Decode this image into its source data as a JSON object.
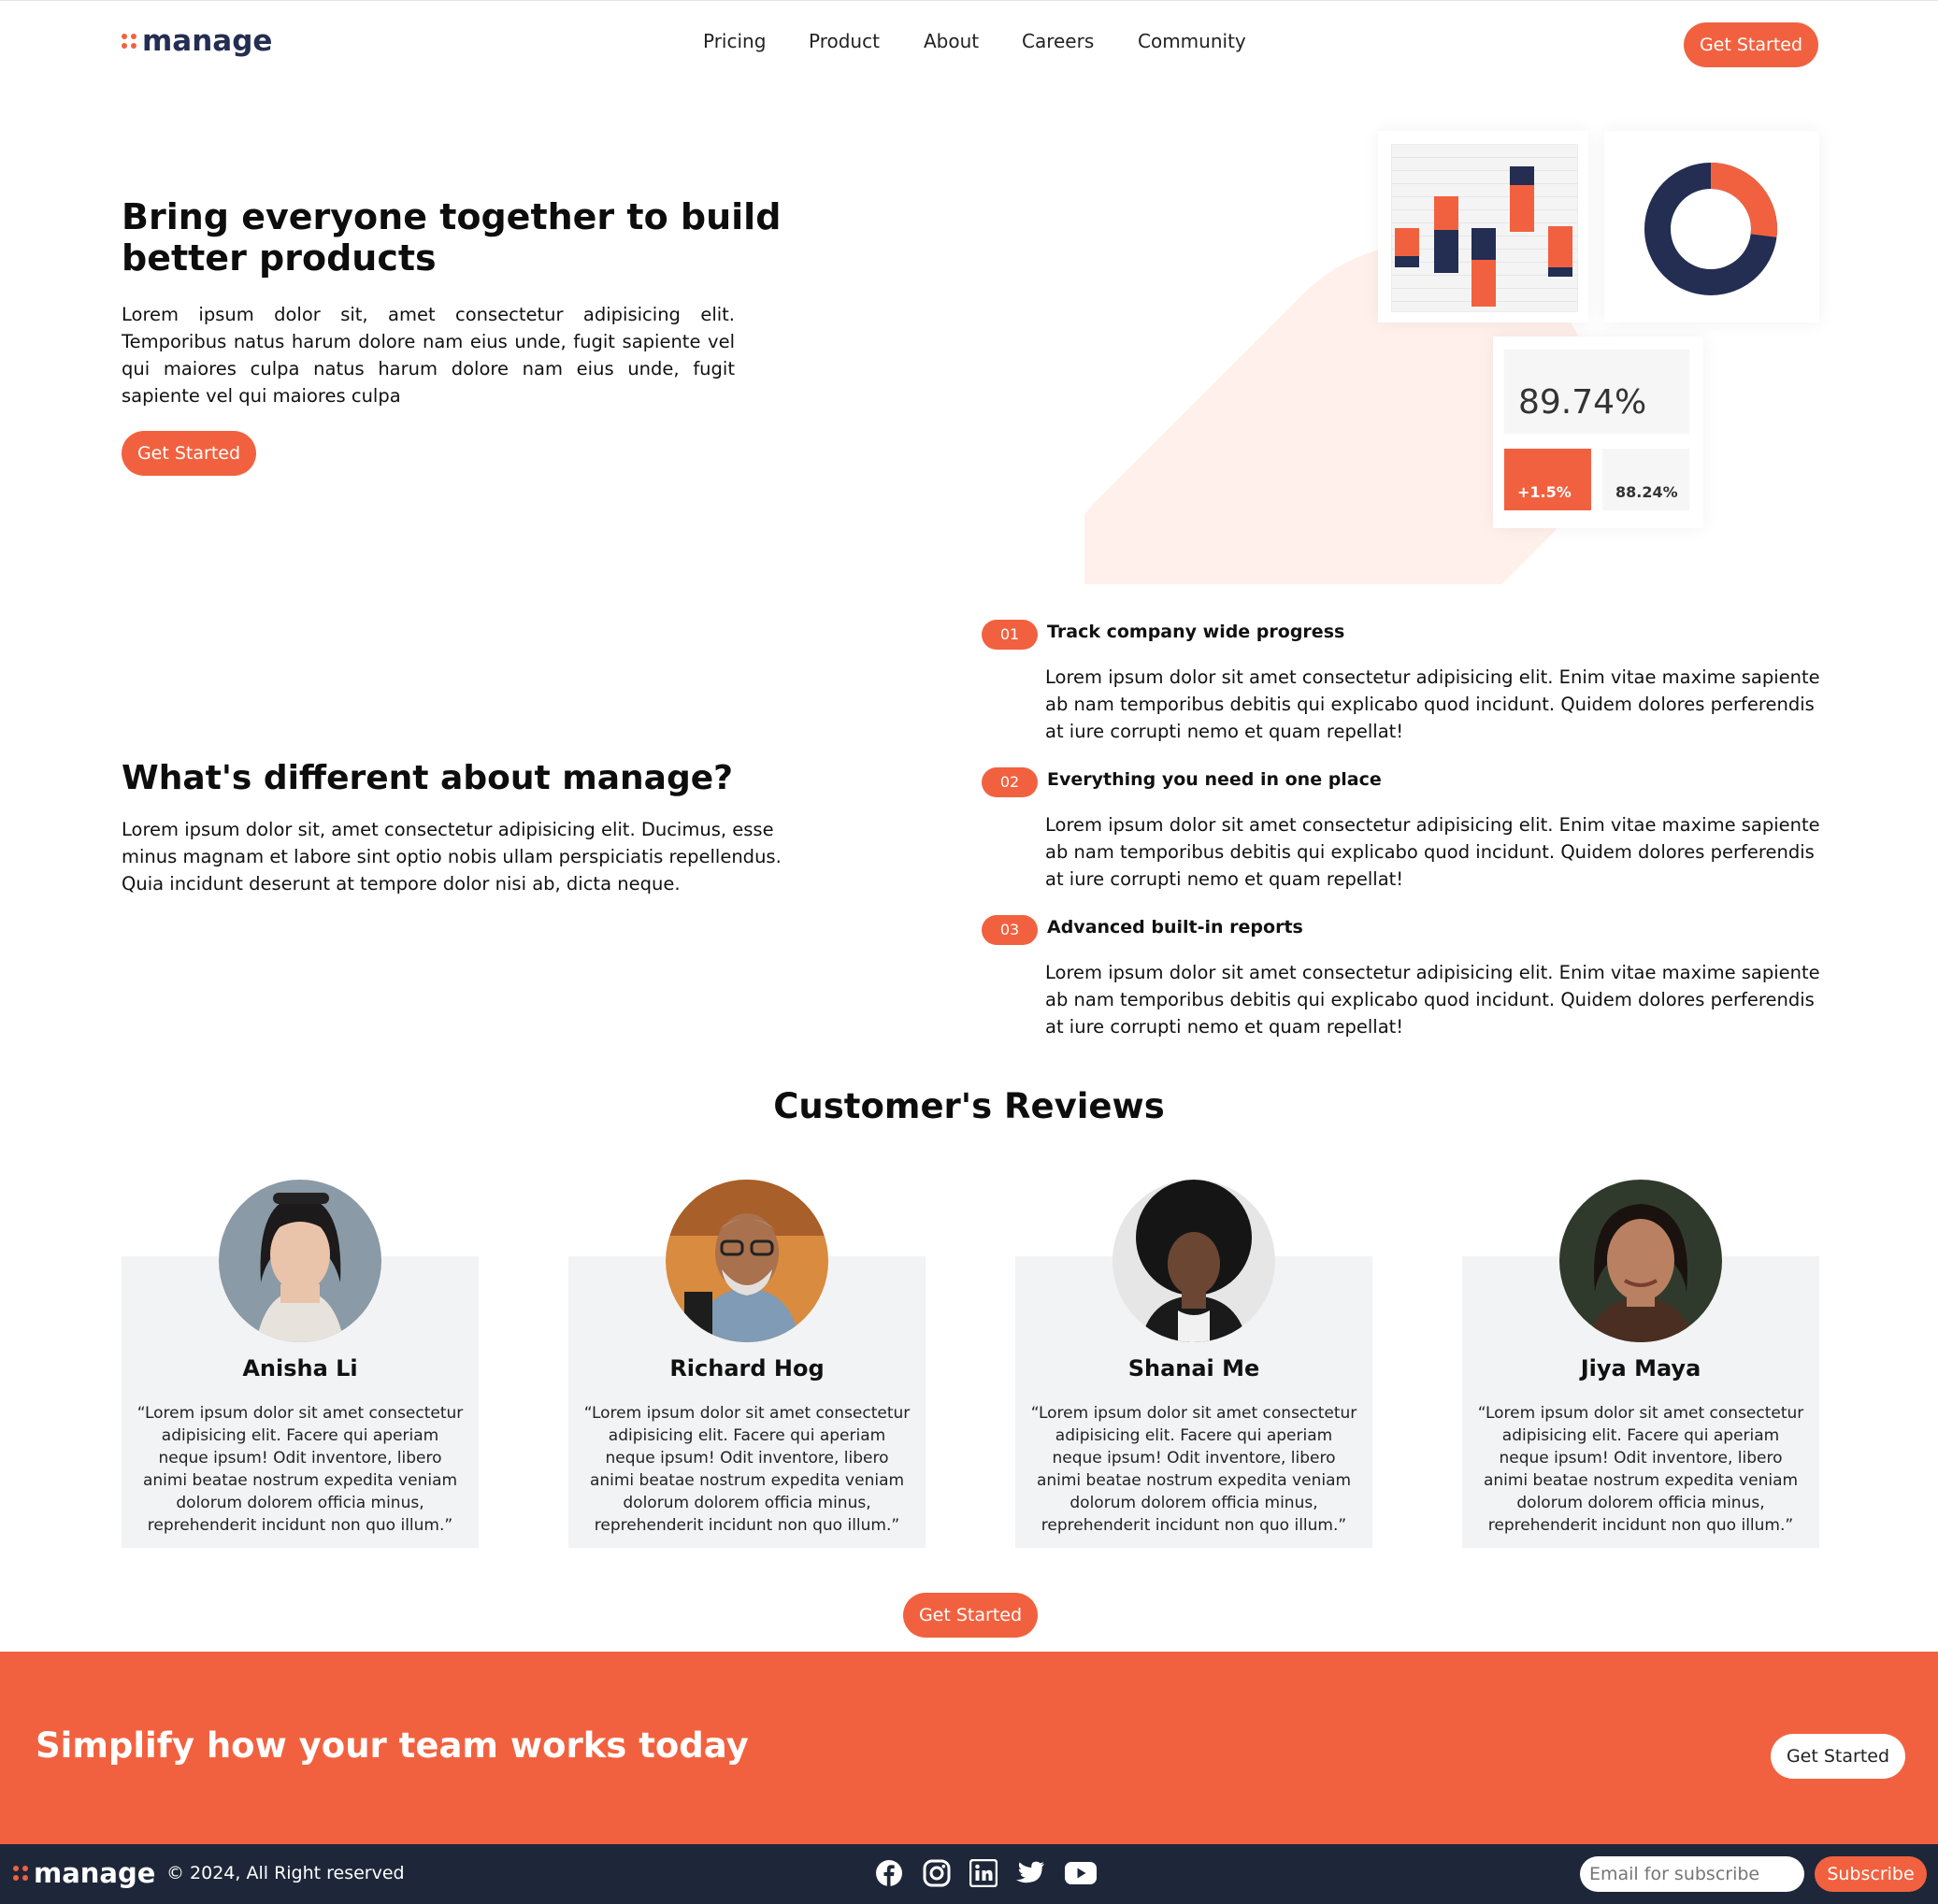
{
  "colors": {
    "accent": "#f2613f",
    "navy": "#242d52",
    "footer_bg": "#1e2739",
    "card_bg": "#f2f3f4",
    "blob": "#fff0ec"
  },
  "header": {
    "logo_text": "manage",
    "nav": [
      "Pricing",
      "Product",
      "About",
      "Careers",
      "Community"
    ],
    "cta_label": "Get Started"
  },
  "hero": {
    "title": "Bring everyone together to build better products",
    "text": "Lorem ipsum dolor sit, amet consectetur adipisicing elit. Temporibus natus harum dolore nam eius unde, fugit sapiente vel qui maiores culpa natus harum dolore nam eius unde, fugit sapiente vel qui maiores culpa",
    "cta_label": "Get Started",
    "stats": {
      "main": "89.74%",
      "change": "+1.5%",
      "secondary": "88.24%"
    },
    "donut_fraction": 0.27
  },
  "different": {
    "title": "What's different about manage?",
    "text": "Lorem ipsum dolor sit, amet consectetur adipisicing elit. Ducimus, esse minus magnam et labore sint optio nobis ullam perspiciatis repellendus. Quia incidunt deserunt at tempore dolor nisi ab, dicta neque.",
    "features": [
      {
        "number": "01",
        "title": "Track company wide progress",
        "text": "Lorem ipsum dolor sit amet consectetur adipisicing elit. Enim vitae maxime sapiente ab nam temporibus debitis qui explicabo quod incidunt. Quidem dolores perferendis at iure corrupti nemo et quam repellat!"
      },
      {
        "number": "02",
        "title": "Everything you need in one place",
        "text": "Lorem ipsum dolor sit amet consectetur adipisicing elit. Enim vitae maxime sapiente ab nam temporibus debitis qui explicabo quod incidunt. Quidem dolores perferendis at iure corrupti nemo et quam repellat!"
      },
      {
        "number": "03",
        "title": "Advanced built-in reports",
        "text": "Lorem ipsum dolor sit amet consectetur adipisicing elit. Enim vitae maxime sapiente ab nam temporibus debitis qui explicabo quod incidunt. Quidem dolores perferendis at iure corrupti nemo et quam repellat!"
      }
    ]
  },
  "reviews": {
    "title": "Customer's Reviews",
    "items": [
      {
        "name": "Anisha Li",
        "text": "“Lorem ipsum dolor sit amet consectetur adipisicing elit. Facere qui aperiam neque ipsum! Odit inventore, libero animi beatae nostrum expedita veniam dolorum dolorem officia minus, reprehenderit incidunt non quo illum.”"
      },
      {
        "name": "Richard Hog",
        "text": "“Lorem ipsum dolor sit amet consectetur adipisicing elit. Facere qui aperiam neque ipsum! Odit inventore, libero animi beatae nostrum expedita veniam dolorum dolorem officia minus, reprehenderit incidunt non quo illum.”"
      },
      {
        "name": "Shanai Me",
        "text": "“Lorem ipsum dolor sit amet consectetur adipisicing elit. Facere qui aperiam neque ipsum! Odit inventore, libero animi beatae nostrum expedita veniam dolorum dolorem officia minus, reprehenderit incidunt non quo illum.”"
      },
      {
        "name": "Jiya Maya",
        "text": "“Lorem ipsum dolor sit amet consectetur adipisicing elit. Facere qui aperiam neque ipsum! Odit inventore, libero animi beatae nostrum expedita veniam dolorum dolorem officia minus, reprehenderit incidunt non quo illum.”"
      }
    ],
    "cta_label": "Get Started"
  },
  "cta_band": {
    "title": "Simplify how your team works today",
    "button_label": "Get Started"
  },
  "footer": {
    "logo_text": "manage",
    "copyright": "© 2024, All Right reserved",
    "social": [
      "facebook-icon",
      "instagram-icon",
      "linkedin-icon",
      "twitter-icon",
      "youtube-icon"
    ],
    "email_placeholder": "Email for subscribe",
    "subscribe_label": "Subscribe"
  }
}
